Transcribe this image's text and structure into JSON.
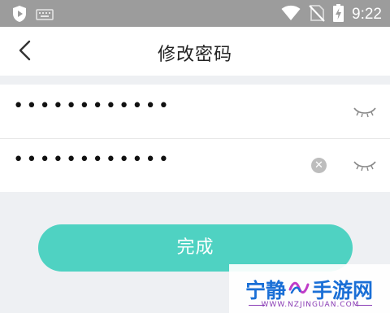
{
  "status_bar": {
    "time": "9:22",
    "icons": [
      "shield-play-icon",
      "keyboard-icon",
      "wifi-icon",
      "no-sim-icon",
      "battery-charging-icon"
    ]
  },
  "header": {
    "title": "修改密码",
    "back_icon": "chevron-left-icon"
  },
  "form": {
    "password1": {
      "value": "••••••••••••",
      "icon": "eye-closed-icon"
    },
    "password2": {
      "value": "••••••••••••",
      "clear_icon": "clear-icon",
      "icon": "eye-closed-icon"
    }
  },
  "done_button": {
    "label": "完成",
    "color": "#4fd2c2"
  },
  "watermark": {
    "brand_left": "宁静",
    "brand_right": "手游网",
    "url": "WWW.NZJINGUAN.COM"
  },
  "colors": {
    "status_bar": "#9c9c9c",
    "accent": "#4fd2c2",
    "background": "#eef0f3"
  }
}
